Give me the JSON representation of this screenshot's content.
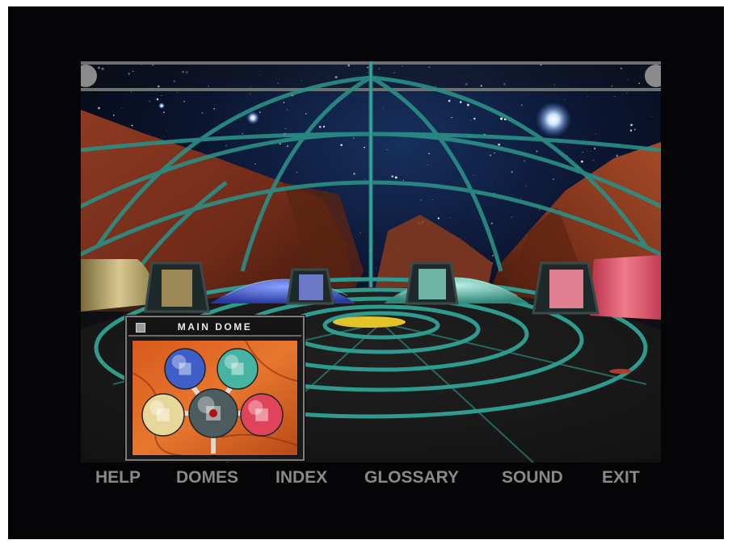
{
  "minimap": {
    "title": "MAIN DOME",
    "domes": [
      {
        "name": "blue-dome",
        "color": "#3f5fc8"
      },
      {
        "name": "teal-dome",
        "color": "#47b3a2"
      },
      {
        "name": "gold-dome",
        "color": "#e8d79a"
      },
      {
        "name": "central-dome",
        "color": "#4d5c5e"
      },
      {
        "name": "red-dome",
        "color": "#e0445a"
      }
    ]
  },
  "menu": {
    "help": "HELP",
    "domes": "DOMES",
    "index": "INDEX",
    "glossary": "GLOSSARY",
    "sound": "SOUND",
    "exit": "EXIT"
  },
  "colors": {
    "frame": "#050508",
    "menu_text": "#8a8a8a",
    "dome_ring": "#2a8f86",
    "floor_center": "#e3c32a"
  }
}
